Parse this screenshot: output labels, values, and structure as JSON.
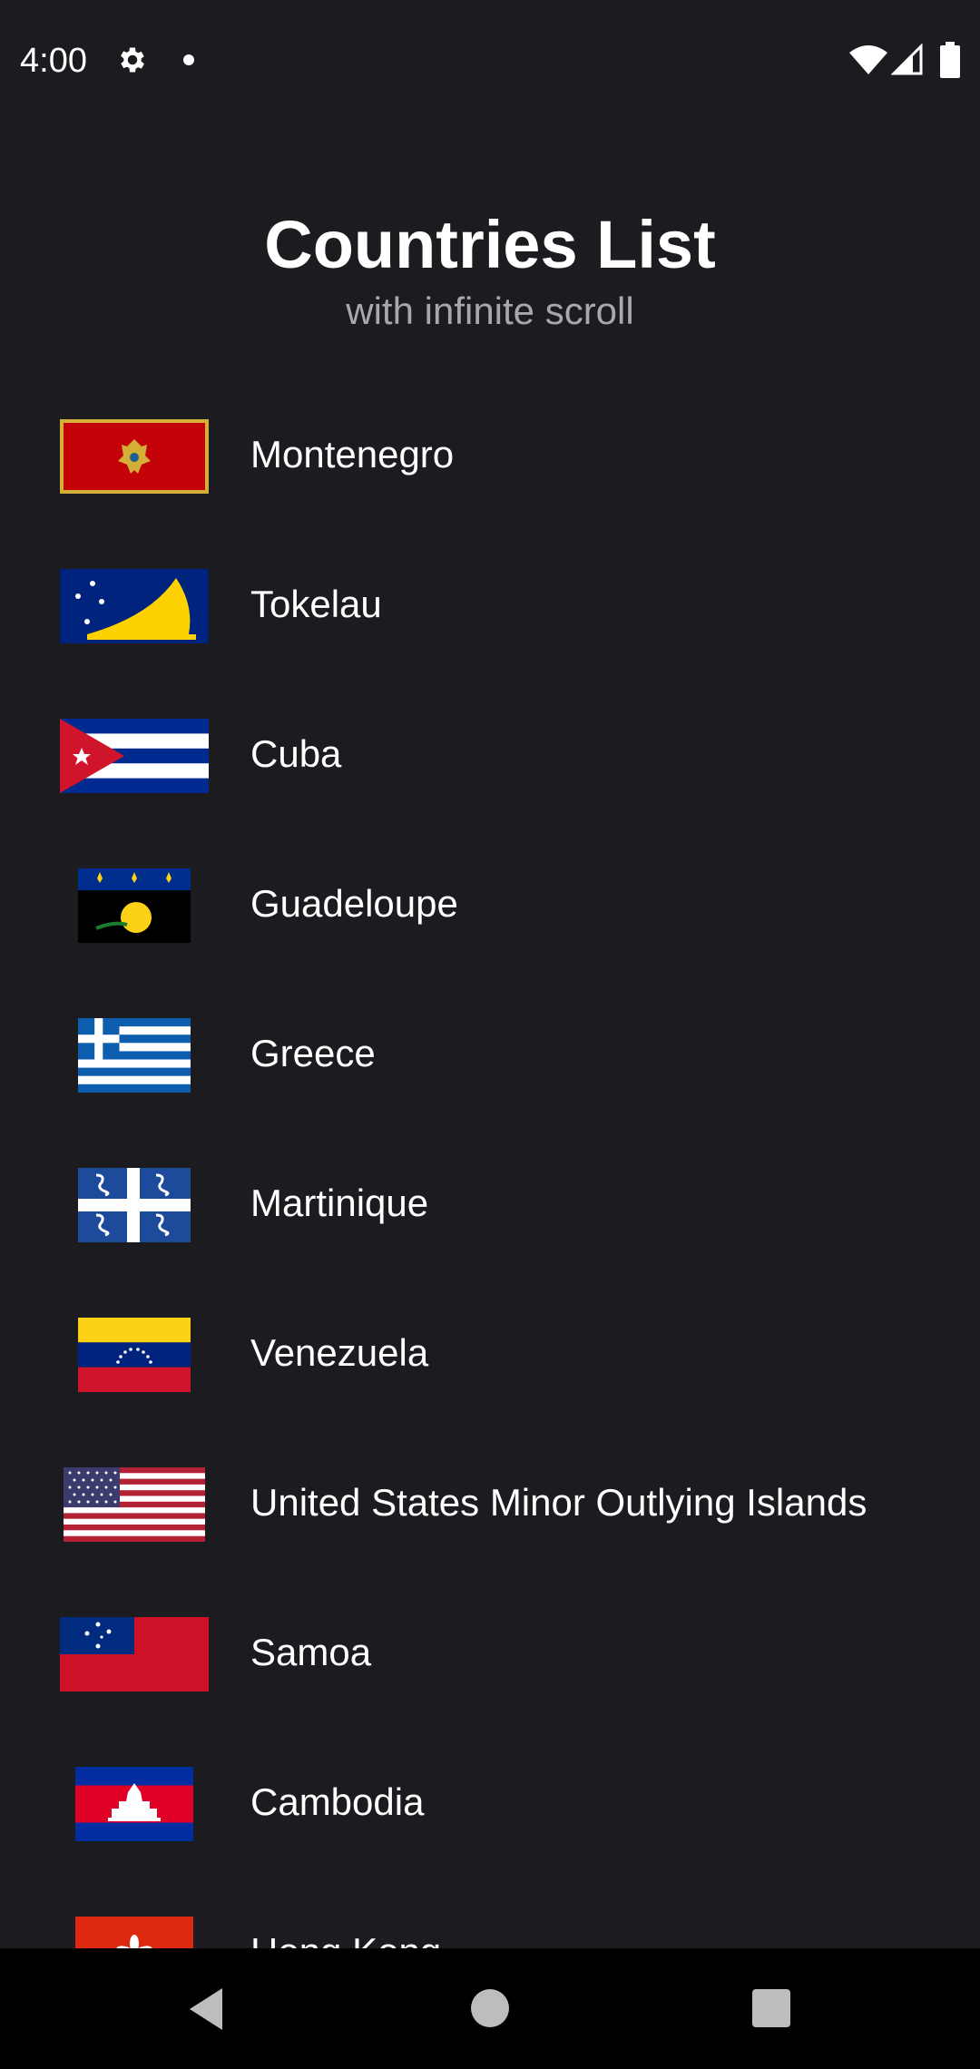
{
  "status_bar": {
    "time": "4:00",
    "icons": [
      "gear-icon",
      "notification-dot-icon",
      "wifi-icon",
      "signal-icon",
      "battery-icon"
    ]
  },
  "header": {
    "title": "Countries List",
    "subtitle": "with infinite scroll"
  },
  "countries": [
    {
      "name": "Montenegro",
      "flag": "montenegro-flag-icon"
    },
    {
      "name": "Tokelau",
      "flag": "tokelau-flag-icon"
    },
    {
      "name": "Cuba",
      "flag": "cuba-flag-icon"
    },
    {
      "name": "Guadeloupe",
      "flag": "guadeloupe-flag-icon"
    },
    {
      "name": "Greece",
      "flag": "greece-flag-icon"
    },
    {
      "name": "Martinique",
      "flag": "martinique-flag-icon"
    },
    {
      "name": "Venezuela",
      "flag": "venezuela-flag-icon"
    },
    {
      "name": "United States Minor Outlying Islands",
      "flag": "usa-flag-icon"
    },
    {
      "name": "Samoa",
      "flag": "samoa-flag-icon"
    },
    {
      "name": "Cambodia",
      "flag": "cambodia-flag-icon"
    },
    {
      "name": "Hong Kong",
      "flag": "hong-kong-flag-icon"
    }
  ],
  "nav_bar": {
    "icons": [
      "back-icon",
      "home-icon",
      "recents-icon"
    ]
  },
  "colors": {
    "background": "#1c1b1f",
    "text": "#ffffff",
    "subtitle": "#a8a8ab",
    "nav_bar": "#000000"
  }
}
